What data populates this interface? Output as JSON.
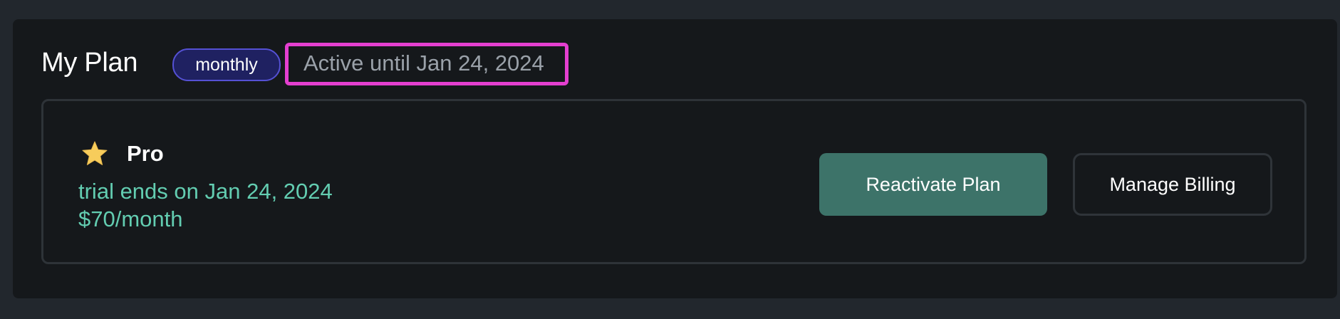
{
  "plan_section": {
    "title": "My Plan",
    "billing_period_badge": "monthly",
    "status_text": "Active until Jan 24, 2024"
  },
  "plan_card": {
    "tier_icon": "star-icon",
    "tier_name": "Pro",
    "trial_text": "trial ends on Jan 24, 2024",
    "price_text": "$70/month"
  },
  "actions": {
    "reactivate_label": "Reactivate Plan",
    "manage_billing_label": "Manage Billing"
  },
  "colors": {
    "page_background": "#22272d",
    "panel_background": "#15181b",
    "badge_background": "#1f2161",
    "badge_border": "#5551d4",
    "highlight_border": "#e43fd0",
    "accent_text": "#63cdb1",
    "primary_button": "#3d7369",
    "star": "#f7cc5b"
  }
}
